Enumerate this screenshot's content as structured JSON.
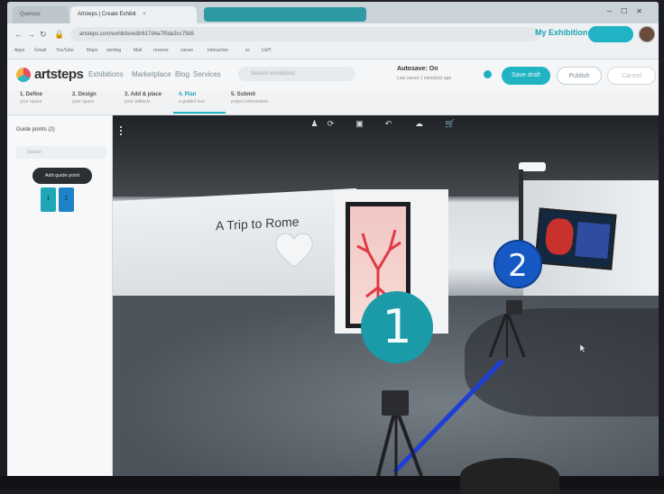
{
  "browser": {
    "tabs": [
      {
        "label": "Quercus",
        "active": false
      },
      {
        "label": "Artsteps | Create Exhibit",
        "active": true
      }
    ],
    "url": "artsteps.com/exhibits/edit/617d4a7f5da3cc75b5",
    "bookmarks": [
      "Apps",
      "Gmail",
      "YouTube",
      "Maps",
      "sterling",
      "Mail",
      "reserve",
      "career",
      "Interactive",
      "sc",
      "UofT"
    ]
  },
  "header": {
    "logo_text": "artsteps",
    "nav": [
      "Exhibitions",
      "Marketplace",
      "Blog",
      "Services"
    ],
    "search_placeholder": "Search exhibitions",
    "my_exhibitions": "My Exhibitions",
    "autosave_label": "Autosave: On",
    "autosave_sub": "Last saved 1 minute(s) ago",
    "buttons": {
      "save": "Save draft",
      "publish": "Publish",
      "cancel": "Cancel"
    }
  },
  "steps": [
    {
      "title": "1. Define",
      "sub": "your space",
      "active": false
    },
    {
      "title": "2. Design",
      "sub": "your space",
      "active": false
    },
    {
      "title": "3. Add & place",
      "sub": "your artifacts",
      "active": false
    },
    {
      "title": "4. Plan",
      "sub": "a guided tour",
      "active": true
    },
    {
      "title": "5. Submit",
      "sub": "project information",
      "active": false
    }
  ],
  "sidebar": {
    "title": "Guide points (2)",
    "search_placeholder": "Search",
    "add_button": "Add guide point",
    "guide_points": [
      "1",
      "2"
    ]
  },
  "scene": {
    "wall_text": "A Trip to Rome",
    "markers": [
      "1",
      "2"
    ],
    "colors": {
      "marker_1": "#1b9aa7",
      "marker_2": "#1659c5",
      "path_line": "#1d3fd6",
      "accent": "#20b3c4"
    }
  },
  "icons": [
    "person-icon",
    "rotate-icon",
    "frame-icon",
    "undo-icon",
    "cloud-icon",
    "cart-icon"
  ]
}
